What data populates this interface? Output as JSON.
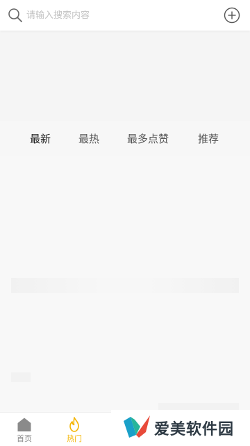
{
  "search": {
    "placeholder": "请输入搜索内容",
    "icon": "search-icon",
    "add_icon": "plus-circle-icon"
  },
  "tabs": [
    {
      "label": "最新",
      "active": true
    },
    {
      "label": "最热",
      "active": false
    },
    {
      "label": "最多点赞",
      "active": false
    },
    {
      "label": "推荐",
      "active": false
    }
  ],
  "bottom_nav": {
    "items": [
      {
        "label": "首页",
        "icon": "home-icon",
        "active": false
      },
      {
        "label": "热门",
        "icon": "flame-icon",
        "active": true
      }
    ]
  },
  "watermark": {
    "text": "爱美软件园"
  },
  "colors": {
    "accent": "#f4b400",
    "inactive": "#888888",
    "background": "#f7f7f7"
  }
}
